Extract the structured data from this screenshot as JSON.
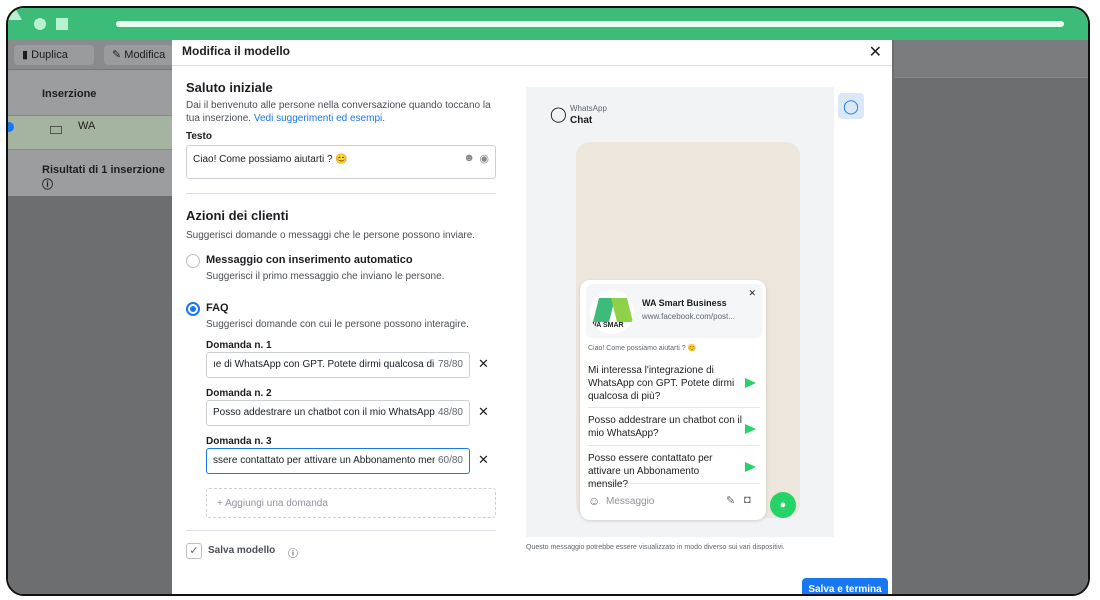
{
  "background_app": {
    "toolbar": {
      "duplicate_label": "Duplica",
      "edit_label": "Modifica"
    },
    "table": {
      "header": "Inserzione",
      "selected_row": "WA",
      "totals_row": "Risultati di 1 inserzione"
    }
  },
  "modal": {
    "title": "Modifica il modello",
    "greeting": {
      "heading": "Saluto iniziale",
      "description": "Dai il benvenuto alle persone nella conversazione quando toccano la tua inserzione.",
      "link": "Vedi suggerimenti ed esempi.",
      "text_label": "Testo",
      "text_value": "Ciao! Come possiamo aiutarti ? 😊"
    },
    "actions": {
      "heading": "Azioni dei clienti",
      "description": "Suggerisci domande o messaggi che le persone possono inviare.",
      "option_auto": {
        "title": "Messaggio con inserimento automatico",
        "description": "Suggerisci il primo messaggio che inviano le persone."
      },
      "option_faq": {
        "title": "FAQ",
        "description": "Suggerisci domande con cui le persone possono interagire."
      },
      "questions": [
        {
          "label": "Domanda n. 1",
          "value": "ıe di WhatsApp con GPT. Potete dirmi qualcosa di più?",
          "count": "78/80"
        },
        {
          "label": "Domanda n. 2",
          "value": "Posso addestrare un chatbot con il mio WhatsApp?",
          "count": "48/80"
        },
        {
          "label": "Domanda n. 3",
          "value": "ssere contattato per attivare un Abbonamento mensile",
          "count": "60/80"
        }
      ],
      "add_question": "+ Aggiungi una domanda"
    },
    "save_template": "Salva modello",
    "save_button": "Salva e termina"
  },
  "preview": {
    "app_name": "WhatsApp",
    "header": "Chat",
    "business_name": "WA Smart Business",
    "business_url": "www.facebook.com/post...",
    "logo_text": "WA SMAR",
    "greeting": "Ciao! Come possiamo aiutarti ? 😊",
    "questions": [
      "Mi interessa l'integrazione di WhatsApp con GPT. Potete dirmi qualcosa di più?",
      "Posso addestrare un chatbot con il mio WhatsApp?",
      "Posso essere contattato per attivare un Abbonamento mensile?"
    ],
    "message_placeholder": "Messaggio",
    "disclaimer": "Questo messaggio potrebbe essere visualizzato in modo diverso sui vari dispositivi."
  },
  "colors": {
    "brand": "#1877f2",
    "whatsapp": "#25d366",
    "titlebar": "#3dbb78"
  }
}
